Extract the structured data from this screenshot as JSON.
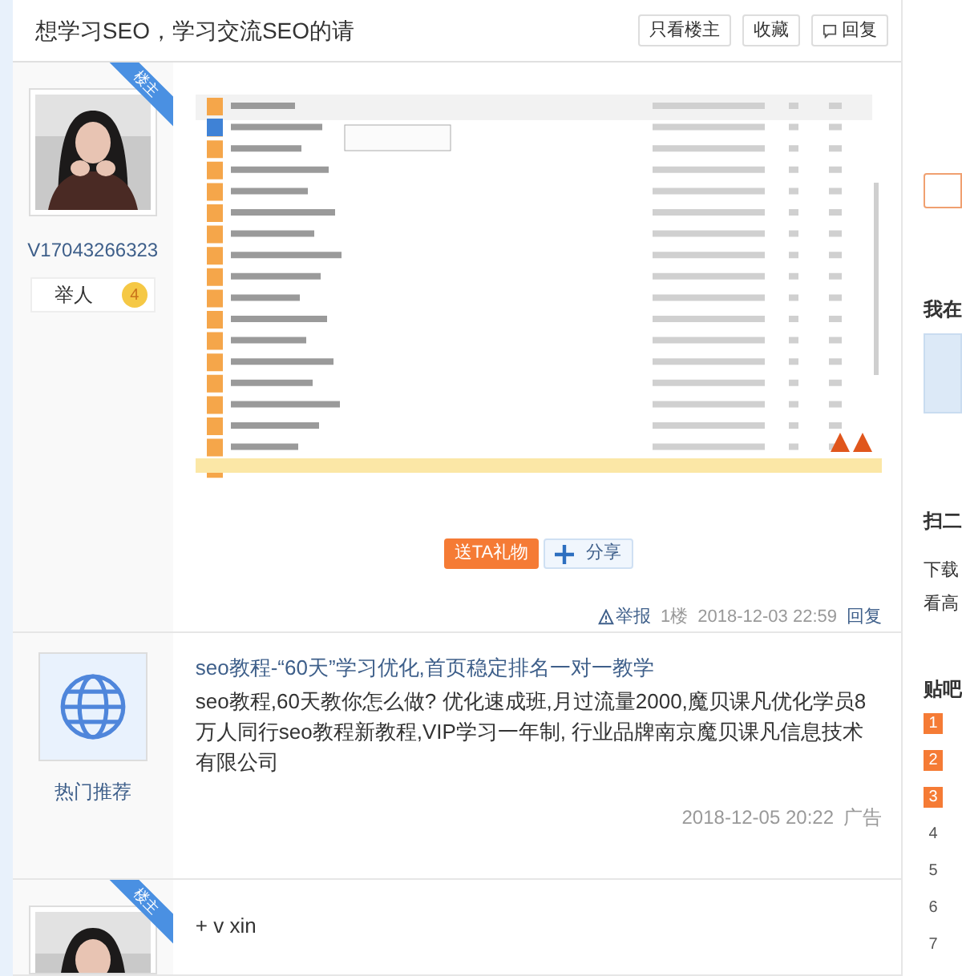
{
  "thread": {
    "title": "想学习SEO，学习交流SEO的请",
    "actions": [
      {
        "label": "只看楼主",
        "kind": "text"
      },
      {
        "label": "收藏",
        "kind": "text"
      },
      {
        "label": "回复",
        "kind": "reply"
      }
    ]
  },
  "posts": [
    {
      "kind": "post",
      "badge": "楼主",
      "username": "V17043266323",
      "role": "举人",
      "level": "4",
      "gift": "送TA礼物",
      "share": "分享",
      "footer": {
        "report": "举报",
        "floor": "1楼",
        "time": "2018-12-03 22:59",
        "reply": "回复"
      }
    },
    {
      "kind": "ad",
      "author": "热门推荐",
      "title": "seo教程-“60天”学习优化,首页稳定排名一对一教学",
      "body": "seo教程,60天教你怎么做? 优化速成班,月过流量2000,魔贝课凡优化学员8万人同行seo教程新教程,VIP学习一年制, 行业品牌南京魔贝课凡信息技术有限公司",
      "time": "2018-12-05 20:22",
      "tag": "广告"
    },
    {
      "kind": "post",
      "badge": "楼主",
      "text": "+ v xin"
    }
  ],
  "sidebar": {
    "heading": "我在",
    "qr_title": "扫二",
    "qr_lines": [
      "下载",
      "看高"
    ],
    "ranking_title": "贴吧",
    "ranks": [
      {
        "number": "1",
        "top": true
      },
      {
        "number": "2",
        "top": true
      },
      {
        "number": "3",
        "top": true
      },
      {
        "number": "4",
        "top": false
      },
      {
        "number": "5",
        "top": false
      },
      {
        "number": "6",
        "top": false
      },
      {
        "number": "7",
        "top": false
      }
    ]
  }
}
